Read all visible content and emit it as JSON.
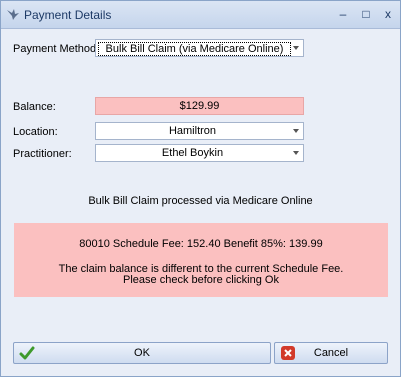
{
  "window": {
    "title": "Payment Details",
    "controls": {
      "minimize": "–",
      "maximize": "□",
      "close": "x"
    }
  },
  "form": {
    "payment_method_label": "Payment Method:",
    "payment_method_value": "Bulk Bill Claim (via Medicare Online)",
    "balance_label": "Balance:",
    "balance_value": "$129.99",
    "location_label": "Location:",
    "location_value": "Hamiltron",
    "practitioner_label": "Practitioner:",
    "practitioner_value": "Ethel Boykin"
  },
  "info": {
    "text": "Bulk Bill Claim processed via Medicare Online"
  },
  "warning": {
    "fee_line": "80010 Schedule Fee: 152.40 Benefit 85%: 139.99",
    "message_line1": "The claim balance is different to the current Schedule Fee.",
    "message_line2": "Please check before clicking Ok",
    "background": "#fbc0c0"
  },
  "buttons": {
    "ok_label": "OK",
    "cancel_label": "Cancel",
    "ok_icon": "checkmark-icon",
    "cancel_icon": "cancel-icon"
  }
}
